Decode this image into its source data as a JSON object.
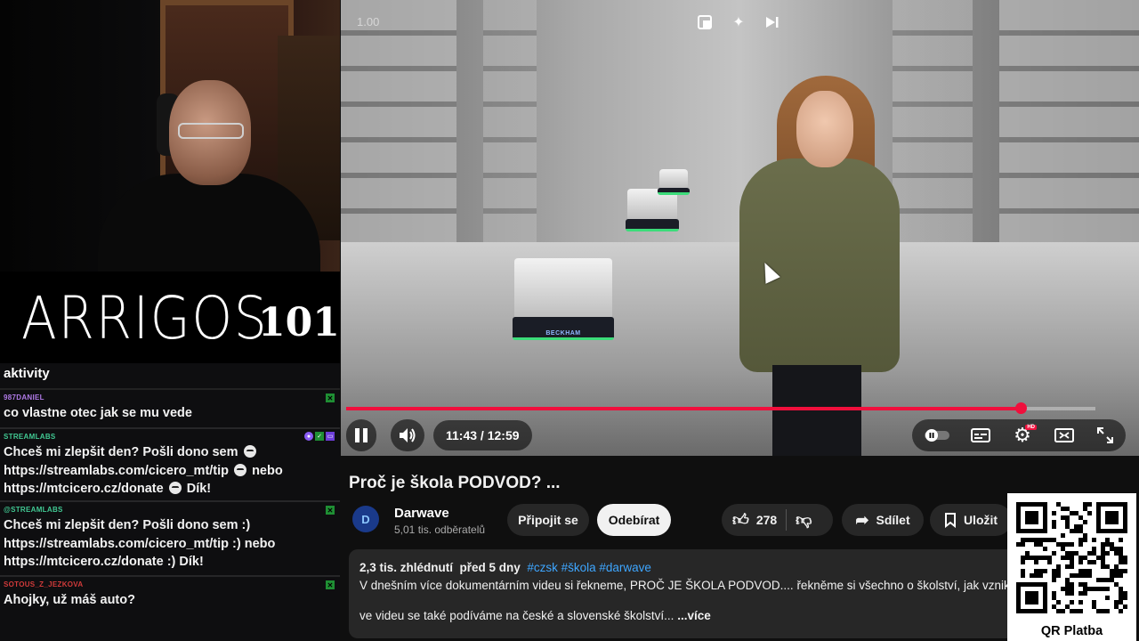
{
  "stream": {
    "logo_name": "ARRIGOS",
    "logo_number": "101"
  },
  "chat": {
    "top_text": "aktivity",
    "messages": [
      {
        "user": "987DANIEL",
        "user_color": "#b07ae8",
        "lines": [
          "co vlastne otec jak se mu vede"
        ]
      },
      {
        "user": "STREAMLABS",
        "user_color": "#41c993",
        "lines": [
          "Chceš mi zlepšit den? Pošli dono sem",
          "https://streamlabs.com/cicero_mt/tip",
          "nebo",
          "https://mtcicero.cz/donate",
          "Dík!"
        ]
      },
      {
        "user": "@STREAMLABS",
        "user_color": "#41c993",
        "lines": [
          "Chceš mi zlepšit den? Pošli dono sem :)",
          "https://streamlabs.com/cicero_mt/tip :) nebo",
          "https://mtcicero.cz/donate :) Dík!"
        ]
      },
      {
        "user": "SOTOUS_Z_JEZKOVA",
        "user_color": "#d13a3a",
        "lines": [
          "Ahojky, už máš auto?"
        ]
      }
    ]
  },
  "player": {
    "speed_label": "1.00",
    "robot_label": "BECKHAM",
    "current_time": "11:43",
    "duration": "12:59",
    "time_display": "11:43 / 12:59",
    "progress": 0.9,
    "accent": "#f00f3c",
    "hd_badge": "HD",
    "icons": [
      "miniplayer-icon",
      "sparkle-icon",
      "skip-next-icon",
      "pause-icon",
      "volume-icon",
      "autoplay-toggle-icon",
      "subtitles-icon",
      "settings-icon",
      "theater-icon",
      "fullscreen-icon"
    ]
  },
  "video": {
    "title": "Proč je škola PODVOD? ...",
    "channel_name": "Darwave",
    "channel_avatar_letter": "D",
    "subscribers": "5,01 tis. odběratelů",
    "join_label": "Připojit se",
    "subscribe_label": "Odebírat",
    "likes": "278",
    "share_label": "Sdílet",
    "save_label": "Uložit",
    "views": "2,3 tis. zhlédnutí",
    "published": "před 5 dny",
    "hashtags": "#czsk #škola #darwave",
    "description_line1": "V dnešním více dokumentárním videu si řekneme, PROČ JE ŠKOLA PODVOD.... řekněme si všechno o školství, jak vzniklo",
    "description_line2": "ve videu se také podíváme na české a slovenské školství...",
    "more_label": "...více"
  },
  "qr": {
    "label": "QR Platba"
  }
}
